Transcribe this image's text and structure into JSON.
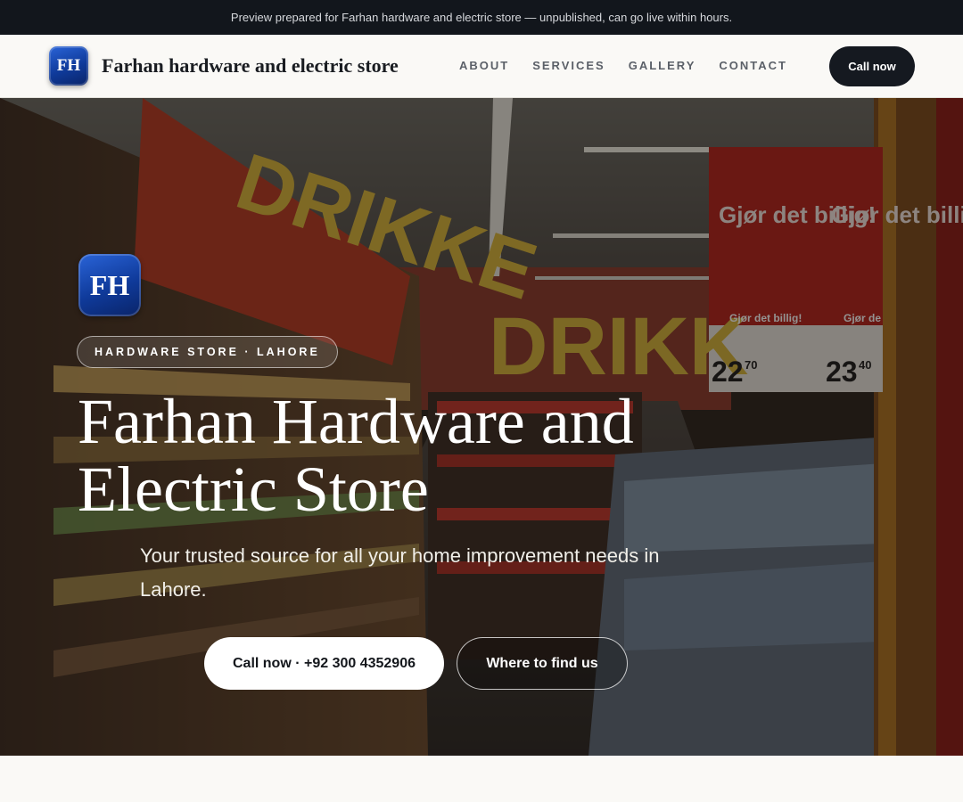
{
  "announcement": "Preview prepared for Farhan hardware and electric store — unpublished, can go live within hours.",
  "logo_text": "FH",
  "brand_name": "Farhan hardware and electric store",
  "nav": {
    "items": [
      "ABOUT",
      "SERVICES",
      "GALLERY",
      "CONTACT"
    ],
    "cta_label": "Call now"
  },
  "hero": {
    "tag": "HARDWARE STORE · LAHORE",
    "title": "Farhan Hardware and Electric Store",
    "subtitle": "Your trusted source for all your home improvement needs in Lahore.",
    "primary_button": "Call now · +92 300 4352906",
    "secondary_button": "Where to find us",
    "background_signs": [
      "DRIKKE",
      "DRIKK",
      "Gjør det billig!",
      "Gjør det billig!",
      "Gjør det billig!",
      "Gjør de",
      "22",
      "70",
      "23",
      "40"
    ]
  },
  "colors": {
    "topbar": "#12161c",
    "nav_background": "#faf9f6",
    "cta_dark": "#151920",
    "logo_blue": "#0f3a9a",
    "sign_red": "#b3221b"
  },
  "icons": [
    "fh-logo-icon"
  ]
}
